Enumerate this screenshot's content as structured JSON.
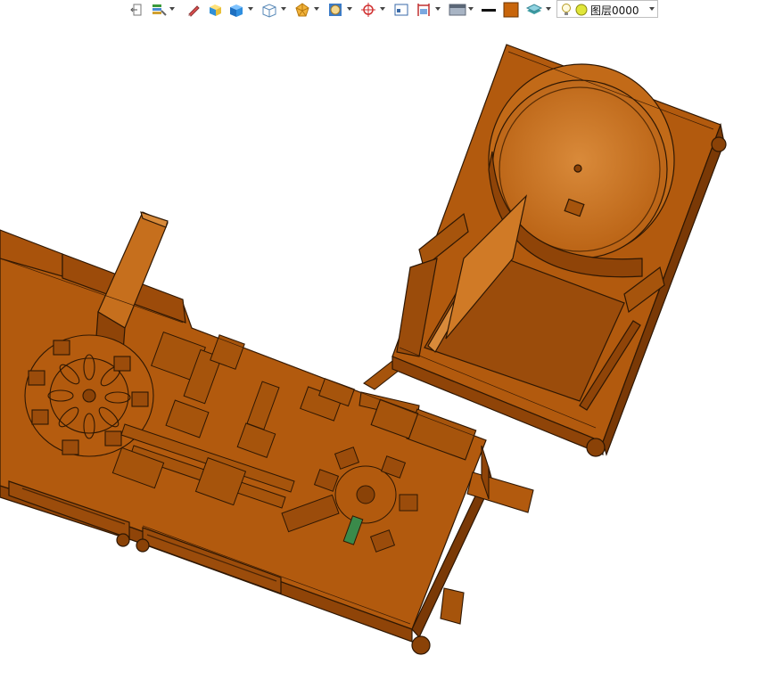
{
  "toolbar": {
    "icons": [
      "exit-icon",
      "layer-paint-icon",
      "pen-icon",
      "box-yellow-icon",
      "box-blue-icon",
      "wireframe-cube-icon",
      "polygon-icon",
      "frame-icon",
      "crosshair-icon",
      "window-icon",
      "dimension-icon",
      "display-mode-icon",
      "line-style-icon",
      "color-swatch-icon",
      "layer-stack-icon",
      "lightbulb-icon",
      "sun-icon"
    ],
    "line_color": "#111111",
    "fill_color": "#c8650b"
  },
  "layer_select": {
    "value": "图层0000"
  },
  "model": {
    "base_color": "#b25a0e",
    "edge_color": "#2e1703",
    "highlight_color": "#d07a26"
  }
}
